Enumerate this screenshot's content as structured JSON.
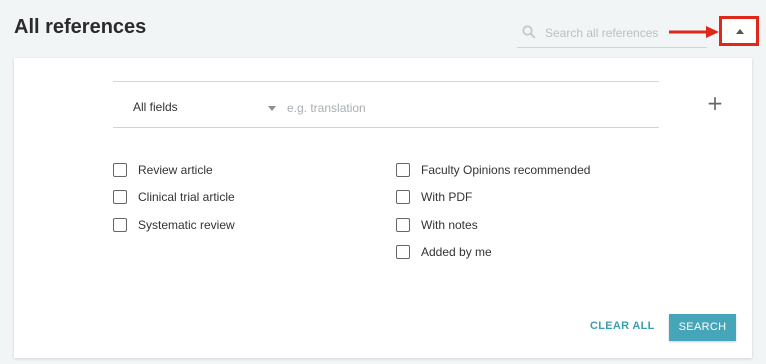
{
  "page": {
    "title": "All references"
  },
  "search": {
    "placeholder": "Search all references",
    "value": ""
  },
  "annotation": {
    "arrow_color": "#e0281a",
    "highlight_color": "#e0281a"
  },
  "advanced": {
    "field_select": "All fields",
    "term_placeholder": "e.g. translation",
    "add_label": "+"
  },
  "filters": {
    "left": [
      {
        "label": "Review article",
        "checked": false
      },
      {
        "label": "Clinical trial article",
        "checked": false
      },
      {
        "label": "Systematic review",
        "checked": false
      }
    ],
    "right": [
      {
        "label": "Faculty Opinions recommended",
        "checked": false
      },
      {
        "label": "With PDF",
        "checked": false
      },
      {
        "label": "With notes",
        "checked": false
      },
      {
        "label": "Added by me",
        "checked": false
      }
    ]
  },
  "actions": {
    "clear_label": "CLEAR ALL",
    "search_label": "SEARCH",
    "accent": "#46a5b8"
  }
}
